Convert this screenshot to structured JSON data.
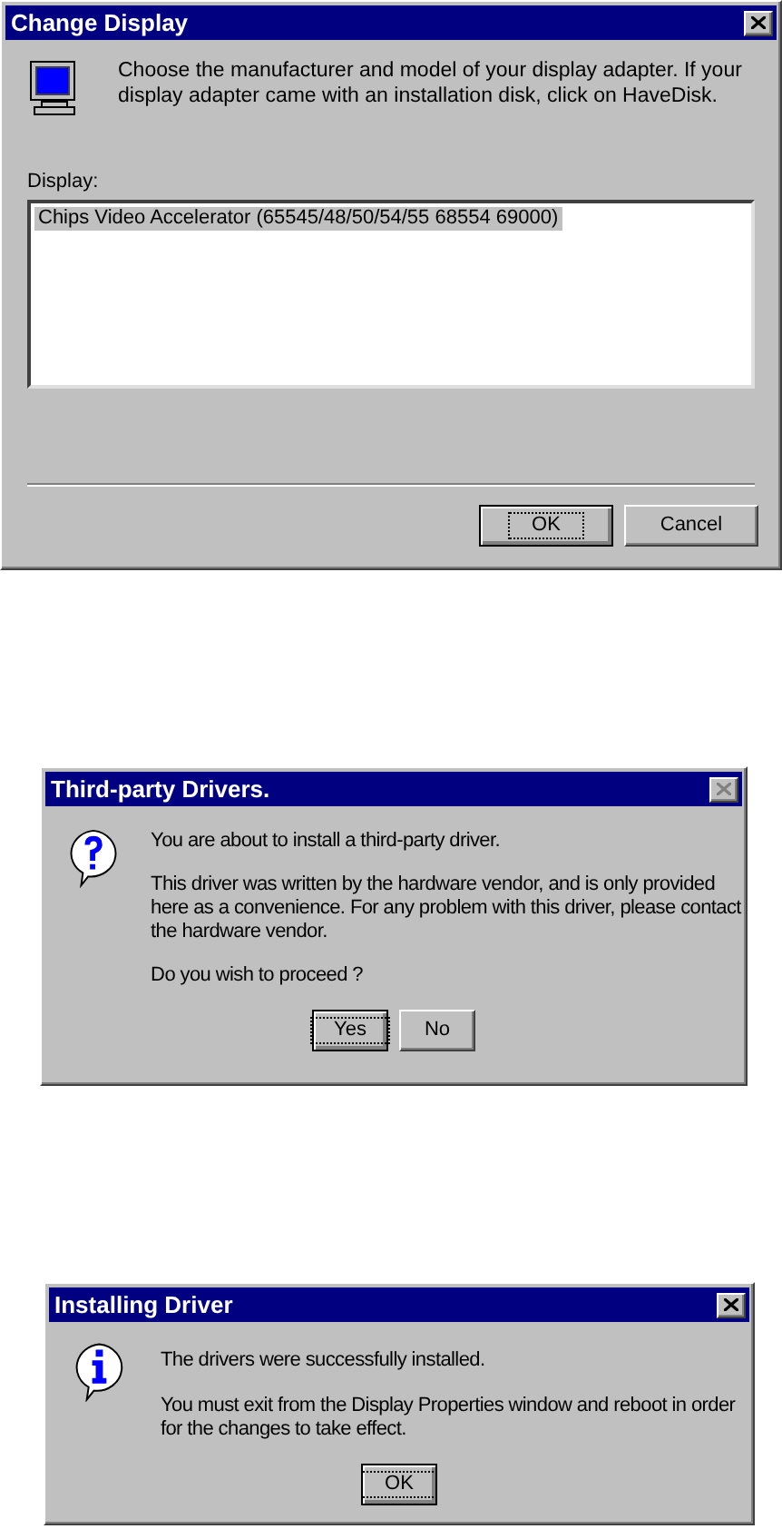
{
  "dialogs": [
    {
      "title": "Change Display",
      "close_disabled": false,
      "kind": "monitor",
      "paragraphs": [
        "Choose the manufacturer and model of your display adapter.  If your display adapter came with an installation disk, click on HaveDisk."
      ],
      "list": {
        "label": "Display:",
        "items": [
          {
            "text": "Chips Video Accelerator (65545/48/50/54/55 68554 69000)",
            "selected": true
          }
        ]
      },
      "buttons": [
        {
          "label": "OK",
          "default": true
        },
        {
          "label": "Cancel",
          "default": false
        }
      ]
    },
    {
      "title": "Third-party Drivers.",
      "close_disabled": true,
      "kind": "question",
      "paragraphs": [
        "You are about to install a third-party driver.",
        "This driver was written by the hardware vendor, and is only provided here as a convenience.  For any problem with this driver, please contact the hardware vendor.",
        "Do you wish to proceed ?"
      ],
      "buttons": [
        {
          "label": "Yes",
          "default": true
        },
        {
          "label": "No",
          "default": false
        }
      ]
    },
    {
      "title": "Installing Driver",
      "close_disabled": false,
      "kind": "info",
      "paragraphs": [
        "The drivers were successfully installed.",
        "You must exit from the Display Properties window and reboot in order for the changes to take effect."
      ],
      "buttons": [
        {
          "label": "OK",
          "default": true
        }
      ]
    }
  ]
}
